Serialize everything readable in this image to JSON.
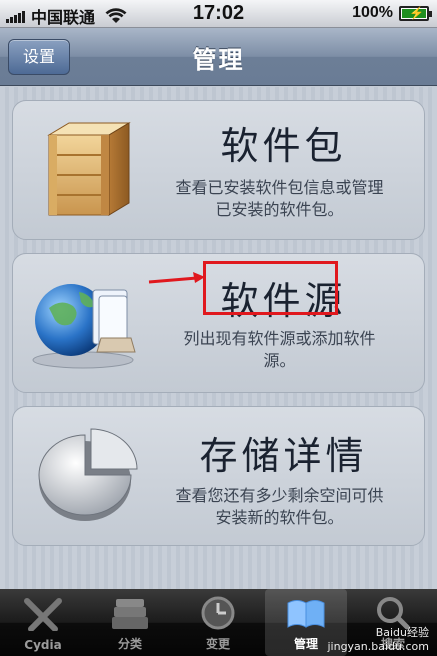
{
  "status_bar": {
    "carrier": "中国联通",
    "time": "17:02",
    "battery": "100%"
  },
  "nav": {
    "back_label": "设置",
    "title": "管理"
  },
  "cards": [
    {
      "title": "软件包",
      "desc_line1": "查看已安装软件包信息或管理",
      "desc_line2": "已安装的软件包。",
      "icon": "wooden-box-icon"
    },
    {
      "title": "软件源",
      "desc_line1": "列出现有软件源或添加软件",
      "desc_line2": "源。",
      "icon": "globe-sources-icon"
    },
    {
      "title": "存储详情",
      "desc_line1": "查看您还有多少剩余空间可供",
      "desc_line2": "安装新的软件包。",
      "icon": "pie-chart-icon"
    }
  ],
  "tabs": [
    {
      "label": "Cydia",
      "icon": "cydia-icon",
      "active": false
    },
    {
      "label": "分类",
      "icon": "sections-icon",
      "active": false
    },
    {
      "label": "变更",
      "icon": "clock-icon",
      "active": false
    },
    {
      "label": "管理",
      "icon": "book-icon",
      "active": true
    },
    {
      "label": "搜索",
      "icon": "search-icon",
      "active": false
    }
  ],
  "watermark": {
    "line1": "Baidu经验",
    "line2": "jingyan.baidu.com"
  },
  "colors": {
    "highlight": "#e0181e",
    "nav_bg": "#7d8ea6"
  }
}
